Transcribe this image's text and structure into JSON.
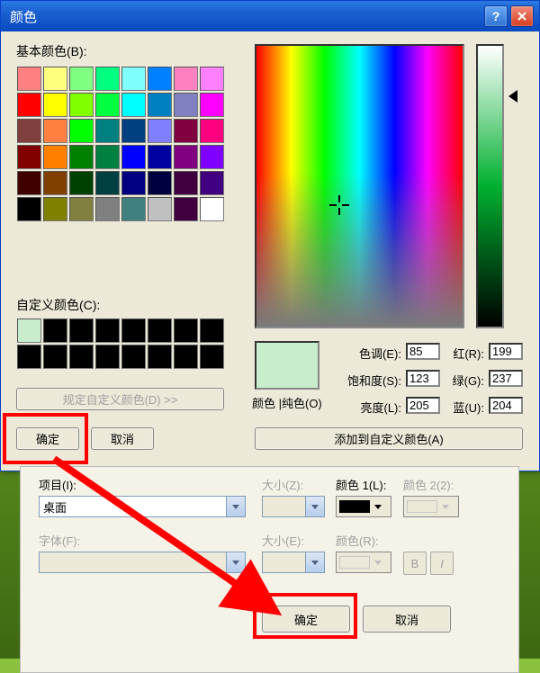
{
  "dialog": {
    "title": "颜色"
  },
  "labels": {
    "basic": "基本颜色(B):",
    "custom": "自定义颜色(C):",
    "define_custom": "规定自定义颜色(D) >>",
    "ok": "确定",
    "cancel": "取消",
    "color_solid": "颜色 |纯色(O)",
    "hue": "色调(E):",
    "sat": "饱和度(S):",
    "lum": "亮度(L):",
    "red": "红(R):",
    "green": "绿(G):",
    "blue": "蓝(U):",
    "add_custom": "添加到自定义颜色(A)"
  },
  "values": {
    "hue": "85",
    "sat": "123",
    "lum": "205",
    "red": "199",
    "green": "237",
    "blue": "204",
    "preview": "#C7EDCC"
  },
  "basic_colors": [
    [
      "#FF8080",
      "#FFFF80",
      "#80FF80",
      "#00FF80",
      "#80FFFF",
      "#0080FF",
      "#FF80C0",
      "#FF80FF"
    ],
    [
      "#FF0000",
      "#FFFF00",
      "#80FF00",
      "#00FF40",
      "#00FFFF",
      "#0080C0",
      "#8080C0",
      "#FF00FF"
    ],
    [
      "#804040",
      "#FF8040",
      "#00FF00",
      "#008080",
      "#004080",
      "#8080FF",
      "#800040",
      "#FF0080"
    ],
    [
      "#800000",
      "#FF8000",
      "#008000",
      "#008040",
      "#0000FF",
      "#0000A0",
      "#800080",
      "#8000FF"
    ],
    [
      "#400000",
      "#804000",
      "#004000",
      "#004040",
      "#000080",
      "#000040",
      "#400040",
      "#400080"
    ],
    [
      "#000000",
      "#808000",
      "#808040",
      "#808080",
      "#408080",
      "#C0C0C0",
      "#400040",
      "#FFFFFF"
    ]
  ],
  "custom_colors": [
    [
      "#C7EDCC",
      "#000000",
      "#000000",
      "#000000",
      "#000000",
      "#000000",
      "#000000",
      "#000000"
    ],
    [
      "#000000",
      "#000000",
      "#000000",
      "#000000",
      "#000000",
      "#000000",
      "#000000",
      "#000000"
    ]
  ],
  "bottom": {
    "item_label": "项目(I):",
    "item_value": "桌面",
    "font_label": "字体(F):",
    "size_label": "大小(Z):",
    "size_label2": "大小(E):",
    "color1_label": "颜色 1(L):",
    "color2_label": "颜色 2(2):",
    "colorR_label": "颜色(R):",
    "ok": "确定",
    "cancel": "取消",
    "color1_value": "#000000"
  }
}
